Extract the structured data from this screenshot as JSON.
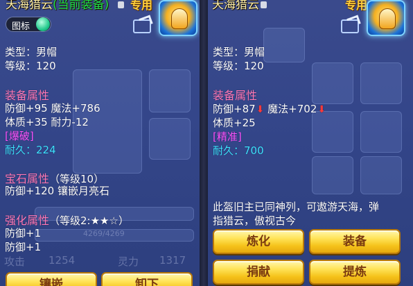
{
  "left": {
    "title_main": "天海猎云",
    "title_tag": "(当前装备)",
    "badge": "专用",
    "toggle_label": "图标",
    "type_line": "类型：男帽",
    "level_line": "等级：120",
    "equip_attr_head": "装备属性",
    "attr1_line": "防御+95 魔法+786",
    "attr2_line": "体质+35 耐力-12",
    "special": "[爆破]",
    "durability": "耐久：224",
    "gem_head": "宝石属性",
    "gem_level": "（等级10）",
    "gem_line": "防御+120 镶嵌月亮石",
    "enhance_head": "强化属性",
    "enhance_level": "（等级2:★★☆）",
    "enhance1": "防御+1",
    "enhance2": "防御+1",
    "bottom_stat1": "攻击",
    "bottom_val1": "1254",
    "bottom_stat2": "灵力",
    "bottom_val2": "1317",
    "bottom_bar": "4269/4269",
    "btn1": "镶嵌",
    "btn2": "卸下"
  },
  "right": {
    "title_main": "天海猎云",
    "badge": "专用",
    "type_line": "类型：男帽",
    "level_line": "等级：120",
    "equip_attr_head": "装备属性",
    "attr_def": "防御+87",
    "attr_magic": "魔法+702",
    "attr2_line": "体质+25",
    "special": "[精准]",
    "durability": "耐久：700",
    "desc_line1": "此盔旧主已同神列，可遨游天海，弹",
    "desc_line2": "指猎云，傲视古今",
    "btn_refine": "炼化",
    "btn_equip": "装备",
    "btn_donate": "捐献",
    "btn_extract": "提炼"
  },
  "icons": {
    "down_arrow": "⬇",
    "helmet": "helmet-icon",
    "share": "share-icon",
    "lock": "lock-icon"
  }
}
